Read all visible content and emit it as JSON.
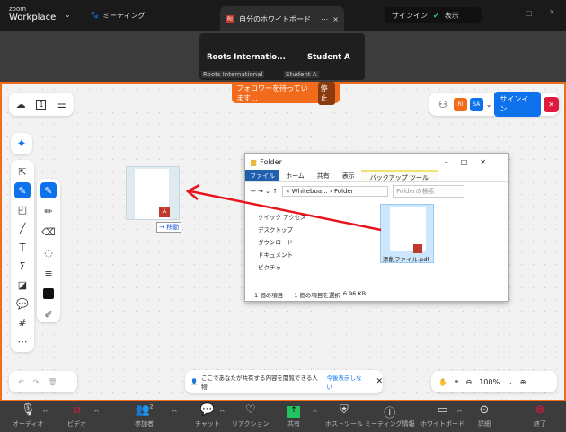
{
  "titlebar": {
    "brand_small": "zoom",
    "brand": "Workplace",
    "meeting": "ミーティング",
    "tab_badge": "RI",
    "tab_title": "自分のホワイトボード",
    "signin": "サインイン",
    "view": "表示"
  },
  "video": {
    "tiles": [
      {
        "name": "Roots Internatio...",
        "label": "Roots International"
      },
      {
        "name": "Student A",
        "label": "Student A"
      }
    ]
  },
  "board": {
    "follow_text": "フォロワーを待っています...",
    "stop": "停止",
    "avatars": [
      "RI",
      "SA"
    ],
    "signin": "サインイン",
    "pages": "1",
    "move_label": "移動",
    "notice": "ここであなたが共有する内容を閲覧できる人物",
    "notice_link": "今後表示しない",
    "zoom": "100%",
    "annotation_color": "#e8131b"
  },
  "explorer": {
    "title": "Folder",
    "ribbon_tabs": [
      "ファイル",
      "ホーム",
      "共有",
      "表示",
      "バックアップ ツール"
    ],
    "path": [
      "Whiteboa...",
      "Folder"
    ],
    "search_placeholder": "Folderの検索",
    "nav": [
      "クイック アクセス",
      "デスクトップ",
      "ダウンロード",
      "ドキュメント",
      "ピクチャ"
    ],
    "file": "添削ファイル.pdf",
    "status": [
      "1 個の項目",
      "1 個の項目を選択",
      "6.96 KB"
    ]
  },
  "toolbar": {
    "items": [
      "オーディオ",
      "ビデオ",
      "参加者",
      "チャット",
      "リアクション",
      "共有",
      "ホストツール",
      "ミーティング情報",
      "ホワイトボード",
      "詳細",
      "終了"
    ],
    "participants_count": "2"
  }
}
